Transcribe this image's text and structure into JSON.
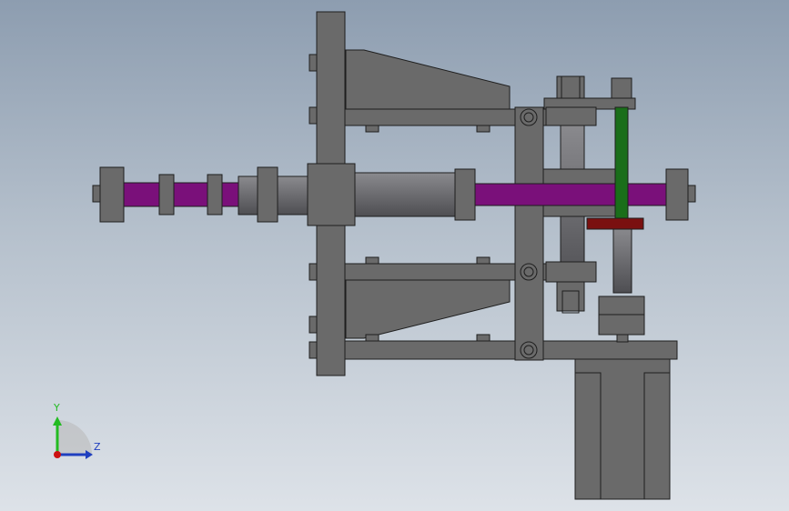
{
  "viewport": {
    "background_top": "#8d9db0",
    "background_bottom": "#dde2e8"
  },
  "model": {
    "part_fill": "#6a6a6a",
    "part_stroke": "#1e1e1e",
    "screw_color": "#7a107a",
    "belt_color": "#1a6e1a",
    "bracket_color": "#7a1010"
  },
  "triad": {
    "y_label": "Y",
    "z_label": "Z",
    "y_color": "#22bb22",
    "z_color": "#1f3fbf",
    "origin_color": "#cc1111"
  }
}
